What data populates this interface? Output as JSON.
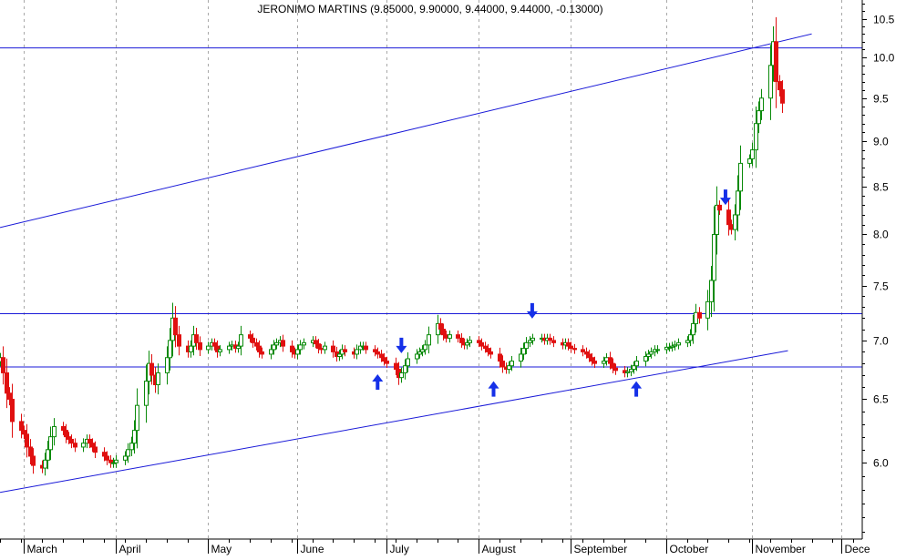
{
  "chart_data": {
    "type": "candlestick",
    "title": "JERONIMO MARTINS (9.85000, 9.90000, 9.44000, 9.44000, -0.13000)",
    "y_scale": "log",
    "ylim": [
      5.45,
      10.75
    ],
    "y_ticks": [
      "6.0",
      "6.5",
      "7.0",
      "7.5",
      "8.0",
      "8.5",
      "9.0",
      "9.5",
      "10.0",
      "10.5"
    ],
    "x_range": [
      "2005-02-21",
      "2005-12-08"
    ],
    "x_month_labels": [
      {
        "date": "2005-03-01",
        "label": "March"
      },
      {
        "date": "2005-04-01",
        "label": "April"
      },
      {
        "date": "2005-05-02",
        "label": "May"
      },
      {
        "date": "2005-06-01",
        "label": "June"
      },
      {
        "date": "2005-07-01",
        "label": "July"
      },
      {
        "date": "2005-08-01",
        "label": "August"
      },
      {
        "date": "2005-09-01",
        "label": "September"
      },
      {
        "date": "2005-10-03",
        "label": "October"
      },
      {
        "date": "2005-11-01",
        "label": "November"
      },
      {
        "date": "2005-12-01",
        "label": "Dece"
      }
    ],
    "grid": {
      "vertical": "dashed",
      "horizontal": false
    },
    "up_color": "#0a8a0a",
    "down_color": "#e01010",
    "line_color": "#1a1ad8",
    "arrow_color": "#1530e8",
    "closes": [
      6.85,
      6.72,
      6.55,
      6.5,
      6.32,
      6.25,
      6.22,
      6.12,
      6.05,
      5.98,
      5.96,
      6.02,
      6.1,
      6.2,
      6.28,
      6.25,
      6.2,
      6.18,
      6.15,
      6.12,
      6.15,
      6.18,
      6.15,
      6.12,
      6.08,
      6.05,
      6.02,
      6.0,
      6.0,
      6.02,
      6.05,
      6.1,
      6.15,
      6.25,
      6.45,
      6.65,
      6.8,
      6.7,
      6.62,
      6.72,
      6.85,
      7.0,
      7.2,
      7.05,
      6.95,
      6.9,
      6.95,
      7.05,
      6.98,
      6.92,
      6.95,
      6.98,
      6.95,
      6.9,
      6.92,
      6.95,
      6.96,
      6.93,
      6.95,
      7.05,
      7.02,
      6.98,
      6.95,
      6.9,
      6.88,
      6.92,
      6.96,
      6.98,
      7.0,
      6.95,
      6.9,
      6.88,
      6.92,
      6.96,
      6.98,
      7.0,
      6.97,
      6.93,
      6.92,
      6.95,
      6.9,
      6.86,
      6.88,
      6.92,
      6.9,
      6.88,
      6.92,
      6.95,
      6.95,
      6.92,
      6.9,
      6.88,
      6.85,
      6.82,
      6.8,
      6.75,
      6.68,
      6.72,
      6.78,
      6.84,
      6.88,
      6.9,
      6.92,
      6.96,
      7.05,
      7.15,
      7.1,
      7.05,
      7.02,
      7.05,
      7.02,
      6.98,
      6.96,
      6.98,
      7.0,
      6.98,
      6.95,
      6.93,
      6.9,
      6.88,
      6.82,
      6.77,
      6.75,
      6.78,
      6.82,
      6.88,
      6.93,
      6.98,
      7.0,
      7.02,
      7.02,
      7.0,
      7.02,
      7.0,
      6.98,
      6.96,
      6.98,
      6.95,
      6.93,
      6.92,
      6.9,
      6.88,
      6.85,
      6.82,
      6.8,
      6.82,
      6.85,
      6.8,
      6.76,
      6.74,
      6.72,
      6.73,
      6.75,
      6.78,
      6.82,
      6.86,
      6.88,
      6.9,
      6.92,
      6.92,
      6.94,
      6.94,
      6.95,
      6.96,
      6.98,
      7.0,
      7.05,
      7.15,
      7.25,
      7.2,
      7.35,
      7.55,
      8.0,
      8.3,
      8.25,
      8.1,
      8.05,
      8.2,
      8.45,
      8.75,
      8.8,
      8.9,
      9.2,
      9.35,
      9.5,
      9.9,
      10.2,
      9.7,
      9.6,
      9.44
    ],
    "lines": [
      {
        "label": "",
        "points": [
          [
            "2005-02-21",
            8.07
          ],
          [
            "2005-11-21",
            10.3
          ]
        ]
      },
      {
        "label": "",
        "points": [
          [
            "2005-02-21",
            5.78
          ],
          [
            "2005-11-13",
            6.91
          ]
        ]
      },
      {
        "label": "",
        "points": [
          [
            "2005-02-21",
            10.12
          ],
          [
            "2005-12-08",
            10.12
          ]
        ]
      },
      {
        "label": "",
        "points": [
          [
            "2005-02-21",
            7.24
          ],
          [
            "2005-12-08",
            7.24
          ]
        ]
      },
      {
        "label": "",
        "points": [
          [
            "2005-02-21",
            6.77
          ],
          [
            "2005-12-08",
            6.77
          ]
        ]
      }
    ],
    "signals": [
      {
        "date": "2005-06-28",
        "type": "buy"
      },
      {
        "date": "2005-07-06",
        "type": "sell"
      },
      {
        "date": "2005-08-06",
        "type": "buy"
      },
      {
        "date": "2005-08-19",
        "type": "sell"
      },
      {
        "date": "2005-09-23",
        "type": "buy"
      },
      {
        "date": "2005-10-23",
        "type": "sell"
      }
    ]
  }
}
